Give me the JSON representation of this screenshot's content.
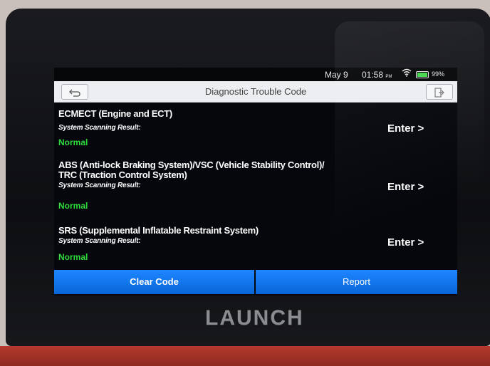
{
  "status_bar": {
    "date": "May 9",
    "time": "01:58",
    "ampm": "PM",
    "battery_percent": "99%",
    "battery_level": 0.99,
    "wifi_icon": "wifi-icon",
    "battery_icon": "battery-icon"
  },
  "title_bar": {
    "title": "Diagnostic Trouble Code",
    "back_icon": "back-arrow-icon",
    "exit_icon": "exit-icon"
  },
  "systems": [
    {
      "name": "ECMECT (Engine and ECT)",
      "result_label": "System Scanning Result:",
      "result": "Normal",
      "enter_label": "Enter >"
    },
    {
      "name_line1": "ABS (Anti-lock Braking System)/VSC (Vehicle Stability Control)/",
      "name_line2": "TRC (Traction Control System)",
      "result_label": "System Scanning Result:",
      "result": "Normal",
      "enter_label": "Enter >"
    },
    {
      "name": "SRS (Supplemental Inflatable Restraint System)",
      "result_label": "System Scanning Result:",
      "result": "Normal",
      "enter_label": "Enter >"
    }
  ],
  "bottom_bar": {
    "clear_code": "Clear Code",
    "report": "Report"
  },
  "device": {
    "logo": "LAUNCH"
  },
  "colors": {
    "normal_status": "#2fdb3a",
    "button_blue": "#0a6fe6",
    "title_bar_bg": "#eceef2",
    "screen_bg": "#05070d"
  }
}
